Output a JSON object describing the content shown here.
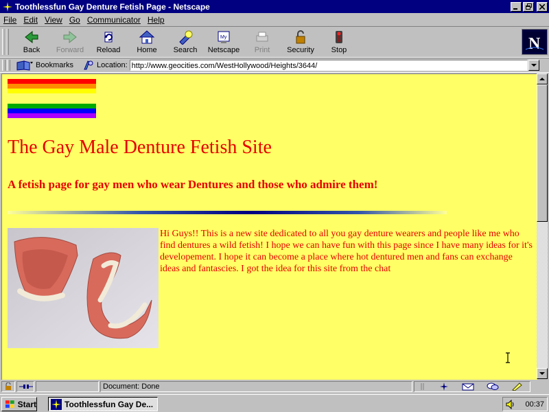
{
  "window": {
    "title": "Toothlessfun Gay Denture Fetish Page - Netscape",
    "controls": {
      "minimize": "_",
      "maximize": "❐",
      "close": "×"
    }
  },
  "menu": [
    "File",
    "Edit",
    "View",
    "Go",
    "Communicator",
    "Help"
  ],
  "toolbar": {
    "back": "Back",
    "forward": "Forward",
    "reload": "Reload",
    "home": "Home",
    "search": "Search",
    "netscape": "Netscape",
    "print": "Print",
    "security": "Security",
    "stop": "Stop"
  },
  "location_bar": {
    "bookmarks_label": "Bookmarks",
    "location_label": "Location:",
    "url": "http://www.geocities.com/WestHollywood/Heights/3644/"
  },
  "page": {
    "background": "#ffff66",
    "text_color": "#e60000",
    "rainbow_colors": [
      "#ff0000",
      "#ff8c00",
      "#ffff00",
      "#00aa00",
      "#0000ff",
      "#aa00ff"
    ],
    "heading": "The Gay Male Denture Fetish Site",
    "subheading": "A fetish page for gay men who wear Dentures and those who admire them!",
    "intro": "Hi Guys!! This is a new site dedicated to all you gay denture wearers and people like me who find dentures a wild fetish! I hope we can have fun with this page since I have many ideas for it's developement. I hope it can become a place where hot dentured men and fans can exchange ideas and fantascies. I got the idea for this site from the chat"
  },
  "status_bar": {
    "message": "Document: Done"
  },
  "taskbar": {
    "start_label": "Start",
    "task_label": "Toothlessfun Gay De...",
    "clock": "00:37"
  }
}
